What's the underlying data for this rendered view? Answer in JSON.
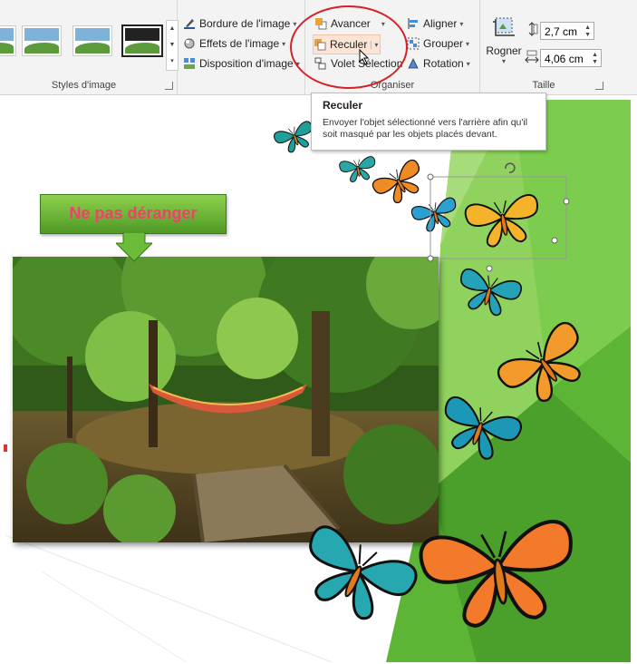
{
  "ribbon": {
    "styles_group": {
      "label": "Styles d'image"
    },
    "picture_commands": {
      "border": "Bordure de l'image",
      "effects": "Effets de l'image",
      "layout": "Disposition d'image"
    },
    "arrange_group": {
      "label": "Organiser",
      "bring_forward": "Avancer",
      "send_backward": "Reculer",
      "selection_pane": "Volet Sélection",
      "align": "Aligner",
      "group": "Grouper",
      "rotate": "Rotation"
    },
    "size_group": {
      "label": "Taille",
      "crop": "Rogner",
      "height": "2,7 cm",
      "width": "4,06 cm"
    }
  },
  "tooltip": {
    "title": "Reculer",
    "description": "Envoyer l'objet sélectionné vers l'arrière afin qu'il soit masqué par les objets placés devant."
  },
  "slide": {
    "callout_text": "Ne pas déranger"
  },
  "colors": {
    "callout_text": "#f43f6b",
    "highlight_circle": "#d81f26",
    "green_bg": "#5cb534"
  }
}
